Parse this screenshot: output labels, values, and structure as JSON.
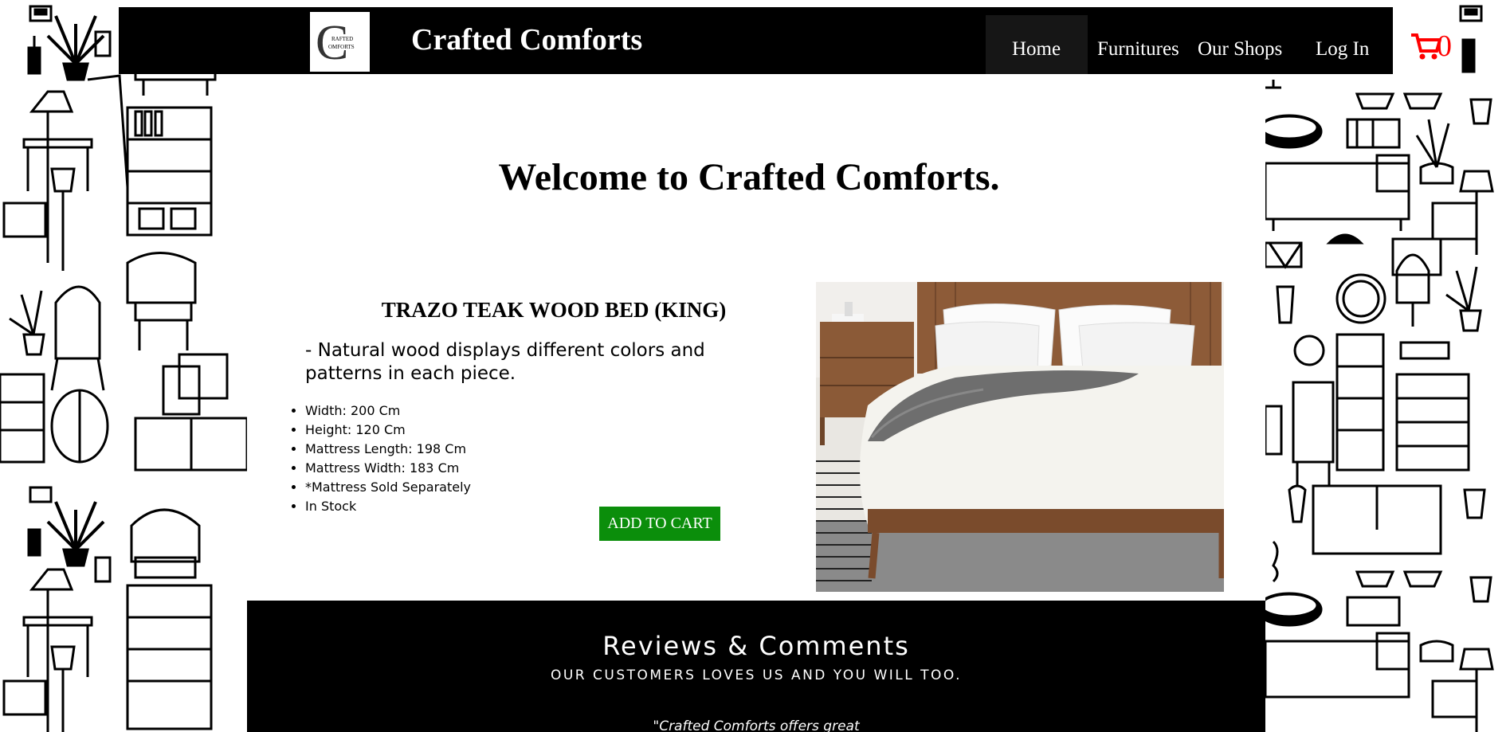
{
  "brand": {
    "name": "Crafted Comforts",
    "logo_text_top": "RAFTED",
    "logo_text_bottom": "OMFORTS",
    "logo_letter": "C"
  },
  "nav": {
    "items": [
      {
        "label": "Home",
        "active": true
      },
      {
        "label": "Furnitures"
      },
      {
        "label": "Our Shops"
      },
      {
        "label": "Log In"
      }
    ],
    "cart_icon": "shopping-cart-icon",
    "cart_count": "0",
    "cart_color": "#ff0000"
  },
  "main": {
    "welcome": "Welcome to Crafted Comforts.",
    "product": {
      "title": "TRAZO TEAK WOOD BED (KING)",
      "description": "- Natural wood displays different colors and patterns in each piece.",
      "specs": [
        "Width: 200 Cm",
        "Height: 120 Cm",
        "Mattress Length: 198 Cm",
        "Mattress Width: 183 Cm",
        "*Mattress Sold Separately",
        "In Stock"
      ],
      "add_to_cart_label": "ADD TO CART",
      "add_to_cart_color": "#0b8e0b"
    }
  },
  "reviews": {
    "title": "Reviews & Comments",
    "subtitle": "OUR CUSTOMERS LOVES US AND YOU WILL TOO.",
    "quote_fragment": "\"Crafted Comforts offers great"
  },
  "colors": {
    "header_bg": "#000000",
    "page_bg": "#ffffff",
    "reviews_bg": "#000000"
  }
}
